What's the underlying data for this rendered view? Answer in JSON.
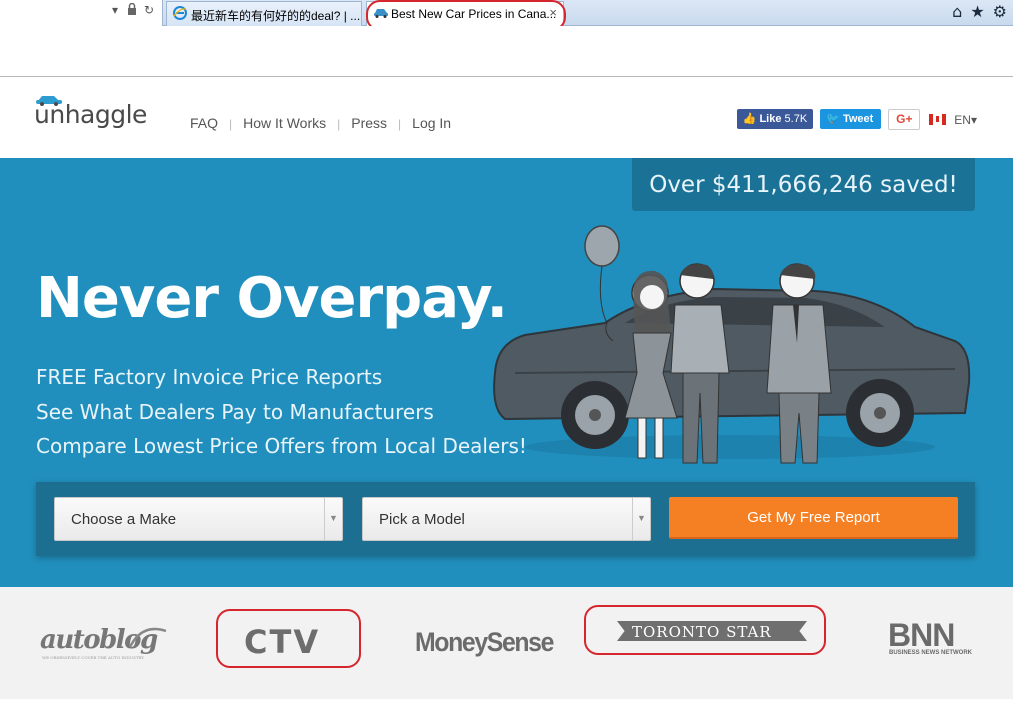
{
  "browser": {
    "tabs": [
      {
        "title": "最近新车的有何好的的deal? | ...",
        "active": false
      },
      {
        "title": "Best New Car Prices in Cana...",
        "active": true
      }
    ],
    "close_glyph": "×",
    "icons": [
      "dropdown-icon",
      "lock-icon",
      "refresh-icon",
      "home-icon",
      "star-icon",
      "gear-icon"
    ]
  },
  "header": {
    "logo": "unhaggle",
    "nav": [
      "FAQ",
      "How It Works",
      "Press",
      "Log In"
    ],
    "social": {
      "facebook_label": "Like",
      "facebook_count": "5.7K",
      "twitter_label": "Tweet",
      "google_label": "G+",
      "language": "EN▾"
    }
  },
  "hero": {
    "saved_banner": "Over $411,666,246 saved!",
    "headline": "Never Overpay.",
    "taglines": [
      "FREE Factory Invoice Price Reports",
      "See What Dealers Pay to Manufacturers",
      "Compare Lowest Price Offers from Local Dealers!"
    ],
    "make_select": "Choose a Make",
    "model_select": "Pick a Model",
    "cta": "Get My Free Report"
  },
  "press": {
    "autoblog": "autoblog",
    "autoblog_tagline": "WE OBSESSIVELY COVER THE AUTO INDUSTRY",
    "ctv": "CTV",
    "moneysense": "MoneySense",
    "torontostar": "TORONTO STAR",
    "bnn": "BNN",
    "bnn_tagline": "BUSINESS NEWS NETWORK"
  },
  "colors": {
    "hero_bg": "#218fbd",
    "panel_bg": "#1c6f91",
    "cta": "#f58024",
    "annotation": "#d6262d"
  }
}
